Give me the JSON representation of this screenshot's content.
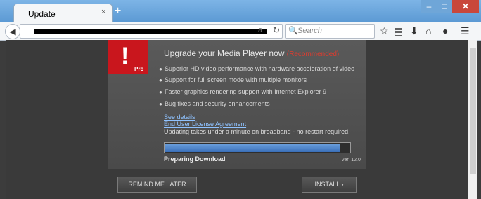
{
  "browser": {
    "tab_title": "Update",
    "tab_close": "×",
    "new_tab": "+",
    "window_controls": {
      "minimize": "–",
      "maximize": "□",
      "close": "✕"
    },
    "url_tail": "a",
    "reload_icon": "↻",
    "search_placeholder": "Search",
    "toolbar_icons": [
      "star-icon",
      "reading-list-icon",
      "download-icon",
      "home-icon",
      "chat-icon",
      "menu-icon"
    ]
  },
  "popup": {
    "logo_mark": "!",
    "logo_badge": "Pro",
    "headline": "Upgrade your Media Player now",
    "recommended": "(Recommended)",
    "features": [
      "Superior HD video performance with hardware acceleration of video",
      "Support for full screen mode with multiple monitors",
      "Faster graphics rendering support with Internet Explorer 9",
      "Bug fixes and security enhancements"
    ],
    "see_details": "See details",
    "eula": "End User License Agreement",
    "updating_note": "Updating takes under a minute on broadband - no restart required.",
    "progress_percent": 95,
    "progress_label": "Preparing Download",
    "version": "ver. 12.0",
    "remind_button": "REMIND ME LATER",
    "install_button": "INSTALL ›"
  }
}
